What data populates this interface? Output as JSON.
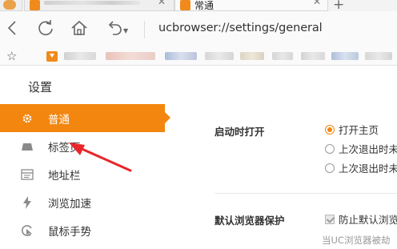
{
  "tabs": {
    "active_title": "常通"
  },
  "toolbar": {
    "url": "ucbrowser://settings/general"
  },
  "settings": {
    "title": "设置"
  },
  "sidebar": {
    "items": [
      {
        "label": "普通",
        "icon": "gear-icon",
        "active": true
      },
      {
        "label": "标签页",
        "icon": "tab-icon",
        "active": false
      },
      {
        "label": "地址栏",
        "icon": "address-bar-icon",
        "active": false
      },
      {
        "label": "浏览加速",
        "icon": "lightning-icon",
        "active": false
      },
      {
        "label": "鼠标手势",
        "icon": "mouse-gesture-icon",
        "active": false
      }
    ]
  },
  "general": {
    "startup_label": "启动时打开",
    "startup_options": [
      "打开主页",
      "上次退出时未",
      "上次退出时未"
    ],
    "default_browser_label": "默认浏览器保护",
    "default_browser_check": "防止默认浏览",
    "default_browser_hint": "当UC浏览器被劫"
  },
  "colors": {
    "accent": "#f3860e",
    "annotation_arrow": "#e8262b"
  }
}
